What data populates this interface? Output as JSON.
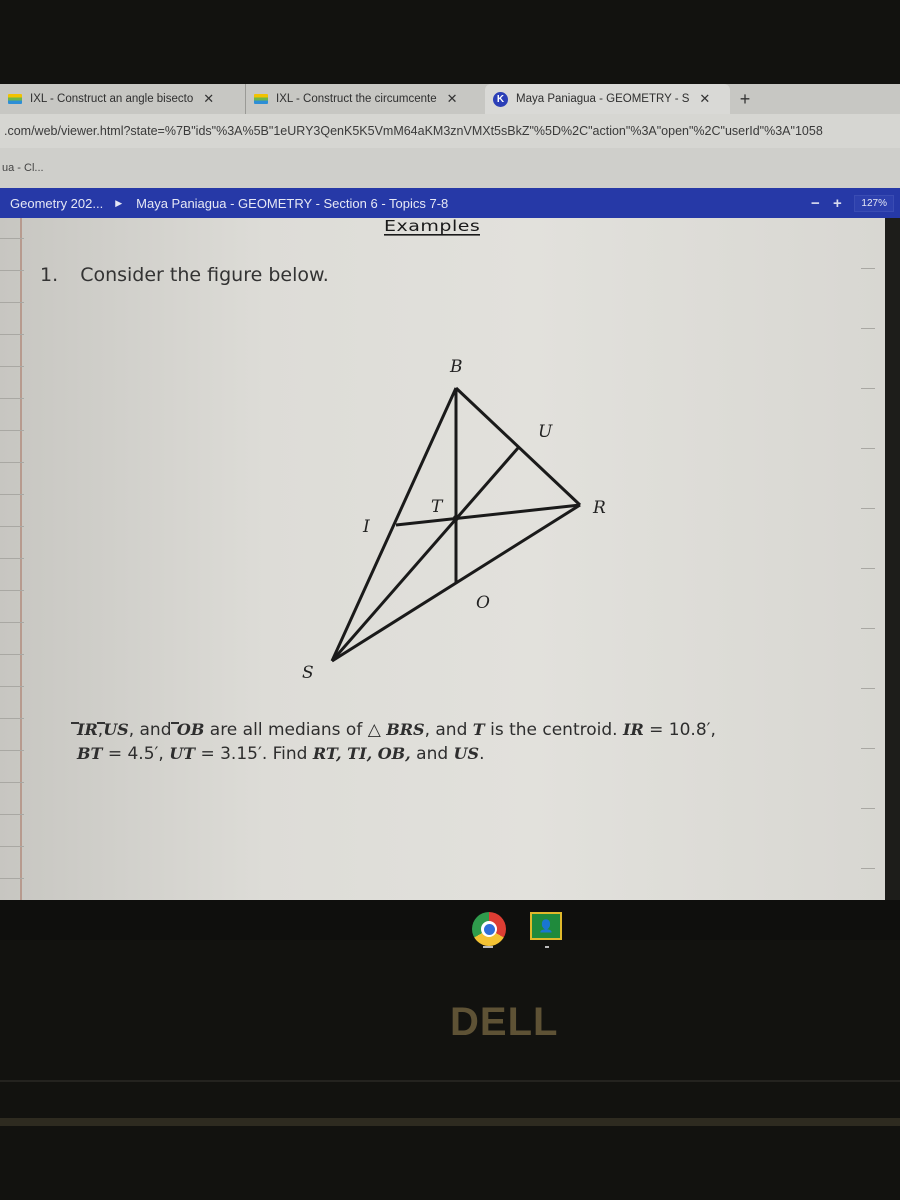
{
  "browser": {
    "tabs": [
      {
        "label": "IXL - Construct an angle bisecto",
        "icon": "ixl-favicon"
      },
      {
        "label": "IXL - Construct the circumcente",
        "icon": "ixl-favicon"
      },
      {
        "label": "Maya Paniagua - GEOMETRY - S",
        "icon": "kami-favicon",
        "favicon_letter": "K",
        "active": true
      }
    ],
    "close_glyph": "✕",
    "new_tab_glyph": "+",
    "url": ".com/web/viewer.html?state=%7B\"ids\"%3A%5B\"1eURY3QenK5K5VmM64aKM3znVMXt5sBkZ\"%5D%2C\"action\"%3A\"open\"%2C\"userId\"%3A\"1058",
    "bookmark": "ua - Cl..."
  },
  "toolbar": {
    "breadcrumb_parent": "Geometry 202...",
    "breadcrumb_sep": "▶",
    "document_title": "Maya Paniagua - GEOMETRY - Section 6 - Topics 7-8",
    "zoom_out": "−",
    "zoom_in": "+",
    "zoom_level": "127%"
  },
  "document": {
    "heading": "Examples",
    "question_number": "1.",
    "question_prompt": "Consider the figure below.",
    "figure_labels": {
      "B": "B",
      "U": "U",
      "T": "T",
      "R": "R",
      "I": "I",
      "O": "O",
      "S": "S"
    },
    "problem": {
      "seg1": "IR",
      "seg2": "US",
      "seg3": "OB",
      "text_and": ", and ",
      "text_medians": " are all medians of △ ",
      "triangle": "BRS",
      "text_centroid_a": ", and ",
      "centroid": "T",
      "text_centroid_b": " is the centroid. ",
      "given1_var": "IR",
      "given1_val": " = 10.8′,",
      "given2_var": "BT",
      "given2_val": " = 4.5′, ",
      "given3_var": "UT",
      "given3_val": " = 3.15′. Find ",
      "find_vars": "RT, TI, OB,",
      "find_and": " and ",
      "find_last": "US",
      "period": "."
    }
  },
  "shelf": {
    "apps": [
      "Chrome",
      "Google Classroom"
    ]
  },
  "hardware": {
    "brand": "DELL"
  }
}
